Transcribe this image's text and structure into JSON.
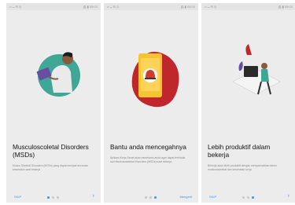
{
  "status_bar": {
    "left": "•• ◒ ✉ ◎",
    "right": "▥ ▮ 08:00"
  },
  "screens": [
    {
      "title": "Musculoscoletal Disorders (MSDs)",
      "description": "Muscu Skeletal Disorders (MSDs) yang dapat menjadi ancaman kesehatan saat bekerja",
      "skip_label": "SKIP",
      "next_icon": "chevron-right-icon",
      "active_dot": 0,
      "illustration": "person-with-laptop-illustration"
    },
    {
      "title": "Bantu anda mencegahnya",
      "description": "Aplikasi Kerja Sehat akan membantu anda agar dapat terhindar dari Muskuloskeletal Disorders (MSDs) saat bekerja",
      "done_label": "Mengerti",
      "active_dot": 1,
      "illustration": "phone-with-alert-illustration"
    },
    {
      "title": "Lebih produktif dalam bekerja",
      "description": "Bekerja akan lebih produktif dengan memperhatikan faktor muskuloskeletal dan kesehatan kerja",
      "skip_label": "SKIP",
      "next_icon": "chevron-right-icon",
      "active_dot": 2,
      "illustration": "person-at-desk-illustration"
    }
  ],
  "colors": {
    "accent": "#3f8ff0",
    "panel_bg": "#ececec",
    "red": "#c0272d",
    "yellow": "#f6c432",
    "teal": "#3fa795",
    "purple": "#6a4ca3"
  }
}
